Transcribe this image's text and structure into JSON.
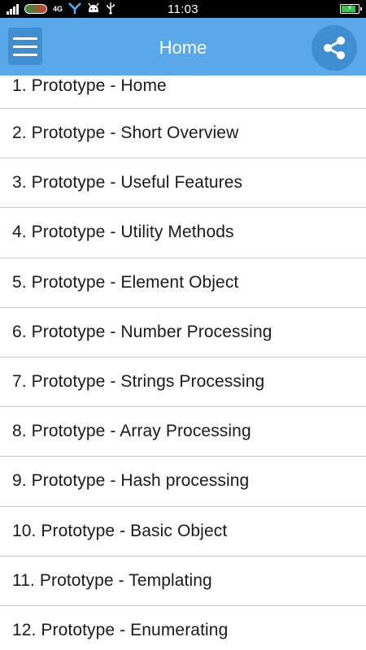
{
  "status_bar": {
    "time": "11:03",
    "network_label": "4G",
    "icons": [
      "signal-icon",
      "carrier-icon",
      "network-icon",
      "share-app-icon",
      "android-icon",
      "usb-icon",
      "battery-charging-icon"
    ],
    "battery_level": 0.9
  },
  "app_bar": {
    "title": "Home",
    "menu_icon": "hamburger-menu-icon",
    "share_icon": "share-icon",
    "color": "#5aa8ea",
    "button_color": "#3f8ed2"
  },
  "list": {
    "items": [
      {
        "label": "1. Prototype - Home"
      },
      {
        "label": "2. Prototype - Short Overview"
      },
      {
        "label": "3. Prototype - Useful Features"
      },
      {
        "label": "4. Prototype - Utility Methods"
      },
      {
        "label": "5. Prototype - Element Object"
      },
      {
        "label": "6. Prototype - Number Processing"
      },
      {
        "label": "7. Prototype - Strings Processing"
      },
      {
        "label": "8. Prototype - Array Processing"
      },
      {
        "label": "9. Prototype - Hash processing"
      },
      {
        "label": "10. Prototype - Basic Object"
      },
      {
        "label": "11. Prototype - Templating"
      },
      {
        "label": "12. Prototype - Enumerating"
      }
    ]
  }
}
